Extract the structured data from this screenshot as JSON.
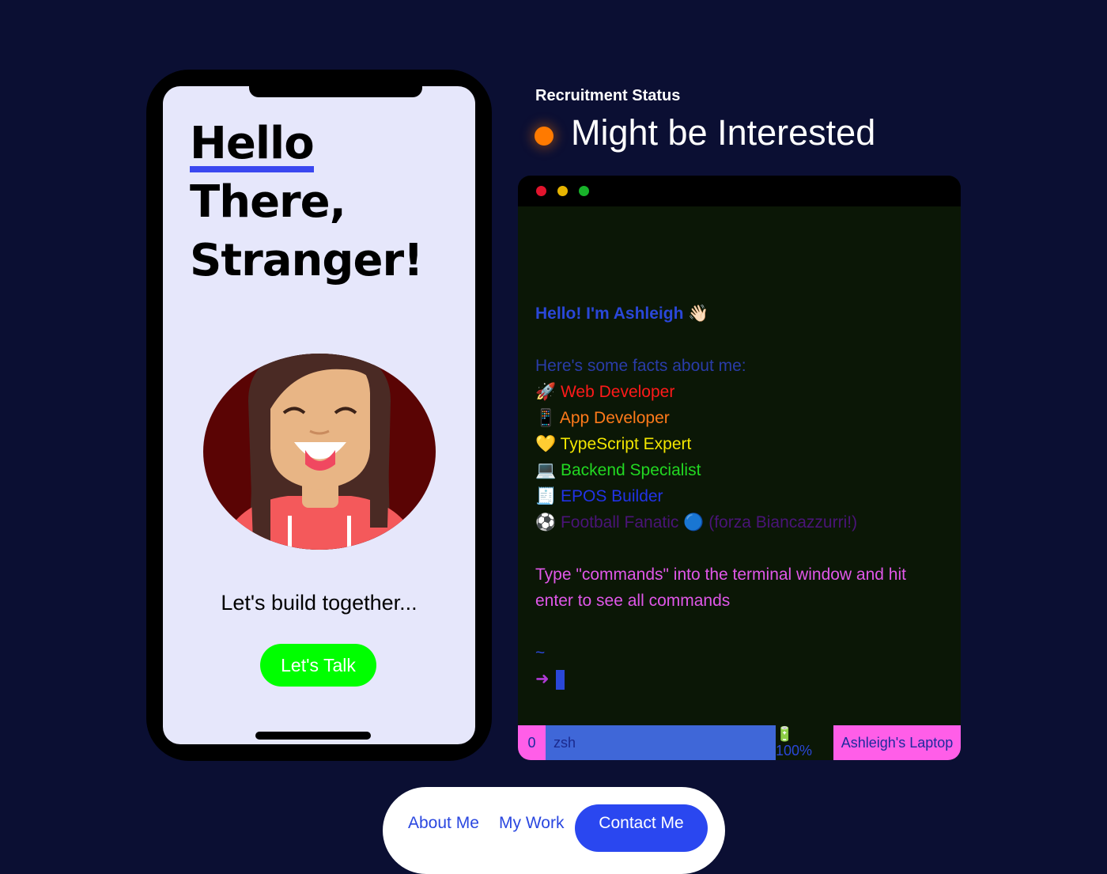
{
  "phone": {
    "heading_lines": [
      "Hello",
      "There,",
      "Stranger!"
    ],
    "tagline": "Let's build together...",
    "cta_label": "Let's Talk"
  },
  "status": {
    "label": "Recruitment Status",
    "value": "Might be Interested",
    "dot_color": "#ff7a00"
  },
  "terminal": {
    "greeting": "Hello! I'm Ashleigh 👋🏻",
    "facts_heading": "Here's some facts about me:",
    "facts": [
      {
        "text": "🚀 Web Developer",
        "color": "#ff1a1a"
      },
      {
        "text": "📱 App Developer",
        "color": "#ff7a1a"
      },
      {
        "text": "💛 TypeScript Expert",
        "color": "#f2e600"
      },
      {
        "text": "💻 Backend Specialist",
        "color": "#22d822"
      },
      {
        "text": "🧾 EPOS Builder",
        "color": "#2233e6"
      },
      {
        "text": "⚽ Football Fanatic 🔵 (forza Biancazzurri!)",
        "color": "#4a1478"
      }
    ],
    "instruction": "Type \"commands\" into the terminal window and hit enter to see all commands",
    "cwd": "~",
    "prompt_symbol": "➜",
    "statusbar": {
      "window_index": "0",
      "shell": "zsh",
      "battery": "🔋 100%",
      "host": "Ashleigh's Laptop"
    }
  },
  "nav": {
    "about": "About Me",
    "work": "My Work",
    "contact": "Contact Me"
  },
  "colors": {
    "background": "#0b0f33",
    "accent": "#2a47f0",
    "cta": "#00ff00"
  }
}
